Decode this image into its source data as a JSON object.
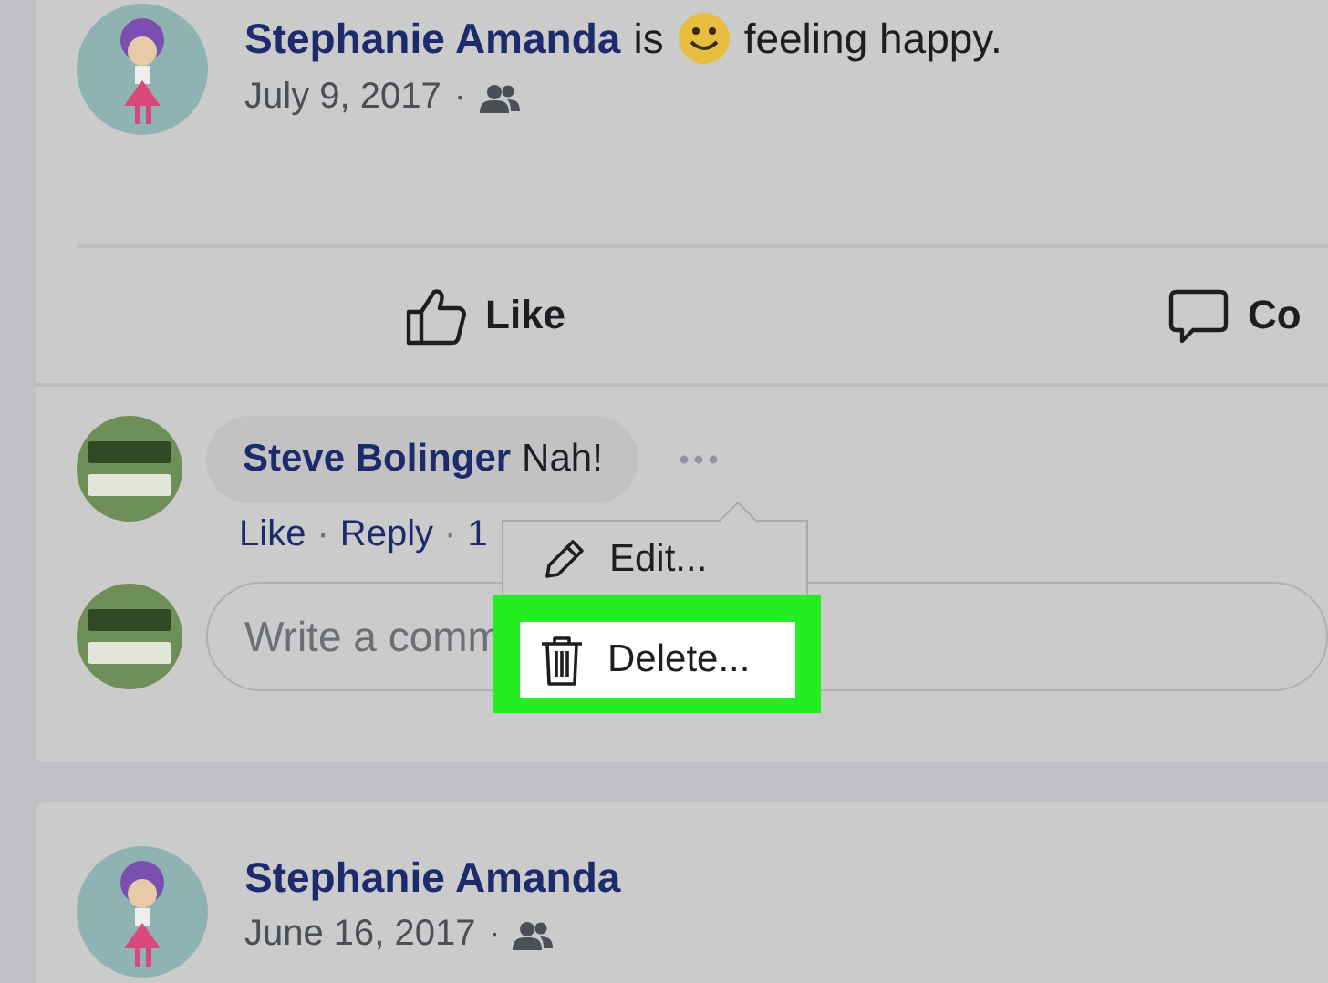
{
  "posts": [
    {
      "author": "Stephanie Amanda",
      "status": {
        "verb": "is",
        "feeling": "feeling happy."
      },
      "date": "July 9, 2017",
      "separator": "·",
      "actions": [
        {
          "kind": "like",
          "label": "Like"
        },
        {
          "kind": "comment",
          "label": "Co"
        }
      ],
      "comments": [
        {
          "author": "Steve Bolinger",
          "text": "Nah!",
          "links": [
            {
              "label": "Like"
            },
            {
              "label": "Reply"
            }
          ],
          "separator": "·",
          "time": "1"
        }
      ],
      "comment_field": {
        "placeholder": "Write a comm"
      }
    },
    {
      "author": "Stephanie Amanda",
      "date": "June 16, 2017",
      "separator": "·"
    }
  ],
  "menu": {
    "items": [
      {
        "kind": "edit",
        "label": "Edit...",
        "highlighted": false
      },
      {
        "kind": "delete",
        "label": "Delete...",
        "highlighted": true
      }
    ]
  }
}
